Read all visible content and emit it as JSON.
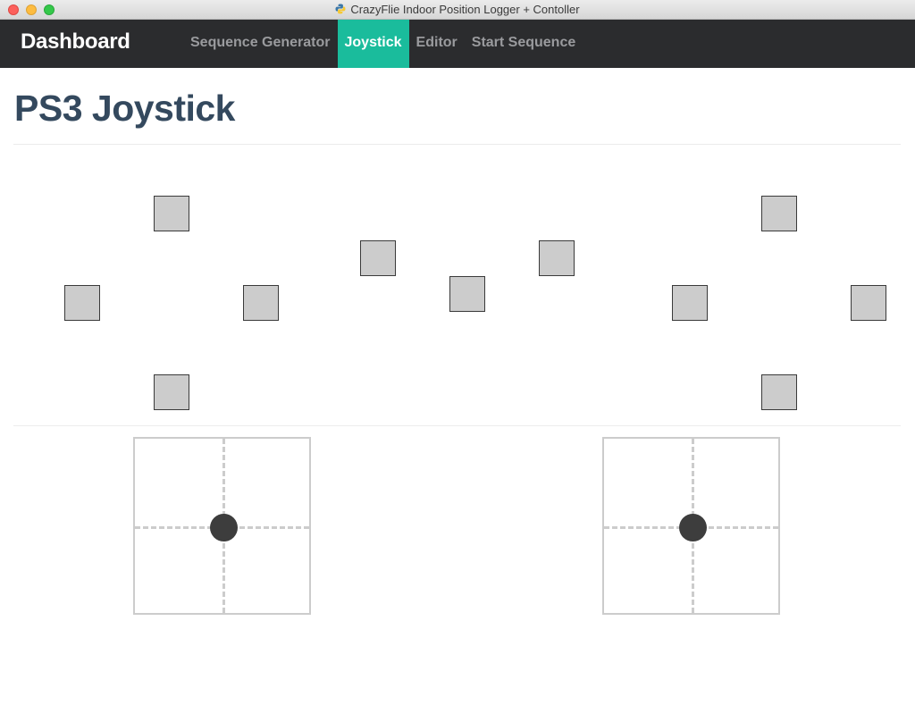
{
  "window": {
    "title": "CrazyFlie Indoor Position Logger + Contoller",
    "app_icon": "python-icon"
  },
  "navbar": {
    "brand": "Dashboard",
    "items": [
      {
        "label": "Sequence Generator",
        "active": false
      },
      {
        "label": "Joystick",
        "active": true
      },
      {
        "label": "Editor",
        "active": false
      },
      {
        "label": "Start Sequence",
        "active": false
      }
    ],
    "active_color": "#1abc9c",
    "background": "#2b2c2e"
  },
  "page": {
    "title": "PS3 Joystick",
    "title_color": "#34495e"
  },
  "controller": {
    "button_color": "#cccccc",
    "analog_sticks": [
      {
        "name": "left-stick",
        "x_value": 0,
        "y_value": 0
      },
      {
        "name": "right-stick",
        "x_value": 0,
        "y_value": 0
      }
    ]
  }
}
